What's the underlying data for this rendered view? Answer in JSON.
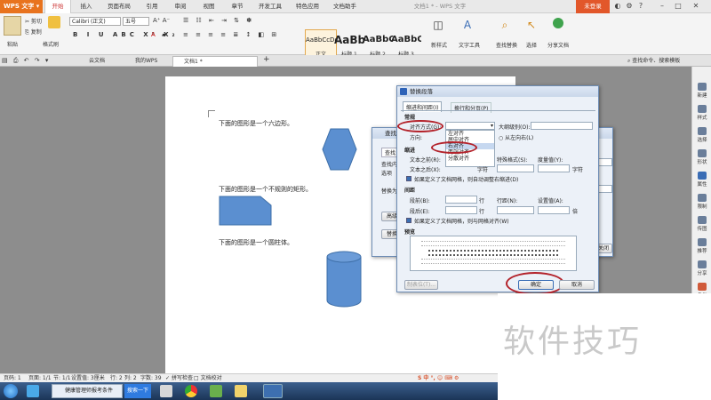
{
  "app": {
    "name": "WPS 文字",
    "doc_title": "文档1 * - WPS 文字",
    "login": "未登录"
  },
  "menu": [
    "开始",
    "插入",
    "页面布局",
    "引用",
    "审阅",
    "视图",
    "章节",
    "开发工具",
    "特色应用",
    "文档助手"
  ],
  "ribbon": {
    "paste": "粘贴",
    "cut": "剪切",
    "copy": "复制",
    "format_painter": "格式刷",
    "font": "Calibri (正文)",
    "size": "五号",
    "styles": [
      {
        "preview": "AaBbCcDd",
        "name": "正文"
      },
      {
        "preview": "AaBb",
        "name": "标题 1"
      },
      {
        "preview": "AaBbC",
        "name": "标题 2"
      },
      {
        "preview": "AaBbC",
        "name": "标题 3"
      }
    ],
    "new_style": "新样式",
    "text_tools": "文字工具",
    "find_replace": "查找替换",
    "select": "选择",
    "share": "分享文档"
  },
  "tabs": [
    "云文档",
    "我的WPS",
    "文档1 *"
  ],
  "search_hint": "查找命令、搜索模板",
  "document": {
    "lines": [
      "下面的图形是一个六边形。",
      "下面的图形是一个不规则的矩形。",
      "下面的图形是一个圆柱体。"
    ]
  },
  "right_panel": [
    "新建",
    "样式",
    "选择",
    "形状",
    "属性",
    "限制",
    "传图",
    "推荐",
    "分享",
    "备份"
  ],
  "find_dialog": {
    "title": "查找",
    "tab": "查找",
    "labels": [
      "查找内",
      "选项",
      "替换为"
    ],
    "buttons": [
      "高级",
      "替换"
    ],
    "close": "关闭"
  },
  "para_dialog": {
    "title": "替换段落",
    "tabs": [
      "缩进和间距(I)",
      "换行和分页(P)"
    ],
    "general": "常规",
    "align_label": "对齐方式(G):",
    "outline_label": "大纲级别(O):",
    "direction_label": "方向:",
    "direction_option": "从左向右(L)",
    "align_options": [
      "左对齐",
      "居中对齐",
      "右对齐",
      "两端对齐",
      "分散对齐"
    ],
    "indent": "缩进",
    "before_text": "文本之前(R):",
    "after_text": "文本之后(X):",
    "char_unit": "字符",
    "special": "特殊格式(S):",
    "measure": "度量值(Y):",
    "grid_check": "如果定义了文档网格，则自动调整右缩进(D)",
    "spacing": "间距",
    "before": "段前(B):",
    "after": "段后(E):",
    "line_unit": "行",
    "line_spacing": "行距(N):",
    "set_value": "设置值(A):",
    "times": "倍",
    "align_grid": "如果定义了文档网格，则与网格对齐(W)",
    "preview": "预览",
    "tabstop": "制表位(T)...",
    "ok": "确定",
    "cancel": "取消"
  },
  "status": {
    "page": "页码: 1",
    "pages": "页面: 1/1",
    "section": "节: 1/1",
    "setting": "设置值: 3厘米",
    "row": "行: 2",
    "col": "列: 2",
    "words": "字数: 39",
    "spell": "拼写检查",
    "proof": "文档校对"
  },
  "taskbar": {
    "items": [
      "健康管理师报考条件",
      "搜索一下"
    ]
  },
  "watermark": "软件技巧"
}
